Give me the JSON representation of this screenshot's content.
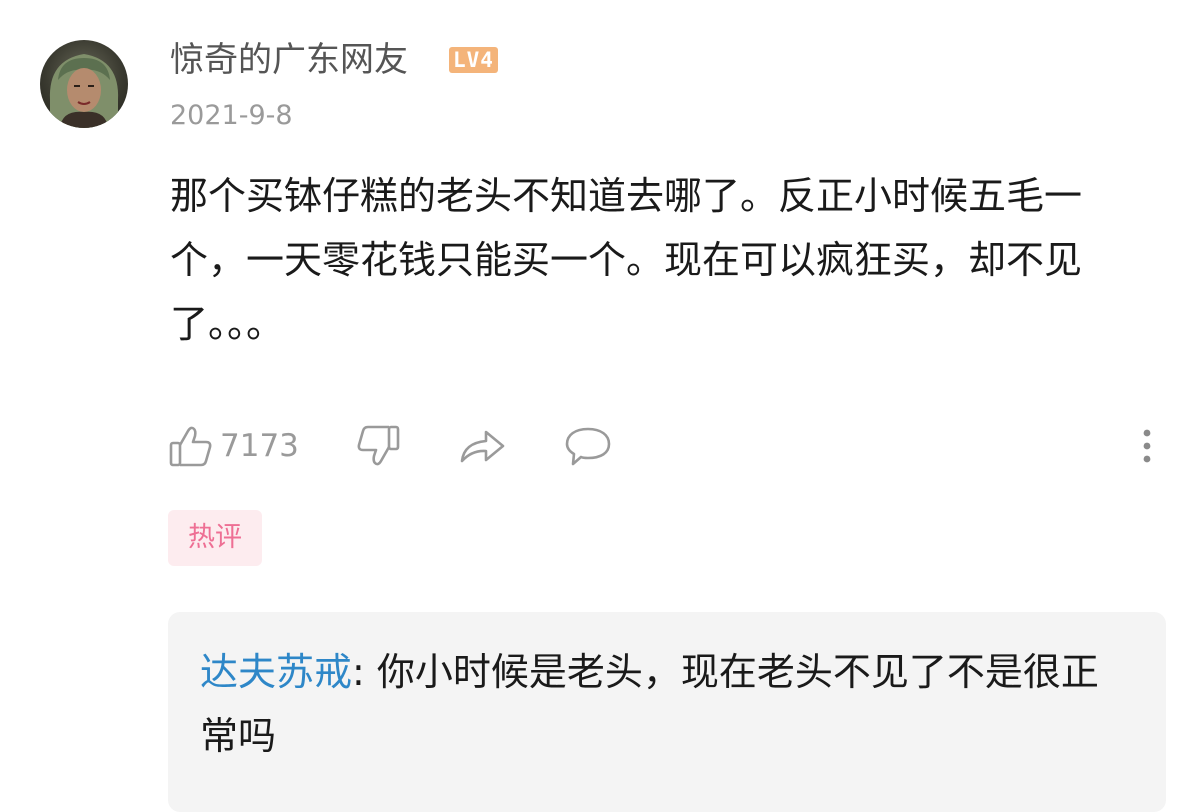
{
  "comment": {
    "username": "惊奇的广东网友",
    "level_badge": "LV4",
    "date": "2021-9-8",
    "text": "那个买钵仔糕的老头不知道去哪了。反正小时候五毛一个，一天零花钱只能买一个。现在可以疯狂买，却不见了。。。",
    "avatar_icon": "user-avatar-portrait",
    "hot_tag": "热评"
  },
  "actions": {
    "like_icon": "thumbs-up-icon",
    "like_count": "7173",
    "dislike_icon": "thumbs-down-icon",
    "share_icon": "share-arrow-icon",
    "reply_icon": "comment-bubble-icon",
    "more_icon": "more-vertical-icon"
  },
  "reply": {
    "author": "达夫苏戒",
    "separator": ": ",
    "text": "你小时候是老头，现在老头不见了不是很正常吗"
  },
  "colors": {
    "username": "#555555",
    "date": "#9a9a9a",
    "level_badge": "#f4b47a",
    "hot_tag_text": "#ee6f94",
    "hot_tag_bg": "#fdecef",
    "reply_author": "#2e87c8",
    "reply_bg": "#f4f4f4",
    "icons": "#9a9a9a"
  }
}
